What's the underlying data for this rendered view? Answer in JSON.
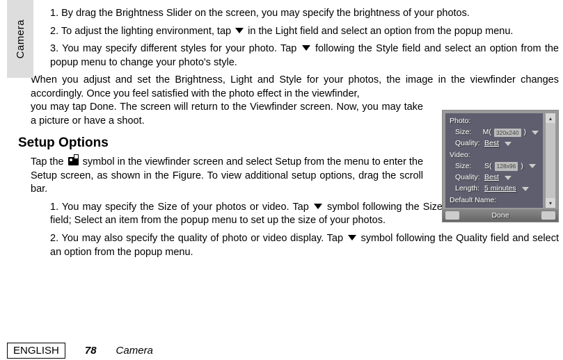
{
  "sideTab": "Camera",
  "list": {
    "i1": "1. By drag the Brightness Slider on the screen, you may specify the brightness of your photos.",
    "i2a": "2.  To adjust the lighting environment, tap ",
    "i2b": " in the Light field and select an option from the popup menu.",
    "i3a": "3.  You may specify different styles for your photo. Tap ",
    "i3b": " following the Style field and select an option from the popup menu to change your photo's style."
  },
  "para1": "When you adjust and set the Brightness, Light and Style for your photos, the image in the viewfinder changes accordingly. Once you feel satisfied with the photo effect in the viewfinder, you may tap Done. The screen will return to the Viewfinder screen. Now, you may take a picture or have a shoot.",
  "heading": "Setup Options",
  "setup": {
    "a": "Tap the ",
    "b": " symbol in the viewfinder screen and select Setup from the menu to enter the Setup screen, as shown in the Figure. To view additional setup options, drag the scroll bar."
  },
  "sub1a": "1. You may specify the Size of your photos or video. Tap ",
  "sub1b": " symbol following the Size field; Select an item from the popup menu to set up the size of your photos.",
  "sub2a": "2. You may also specify the quality of photo or video display. Tap ",
  "sub2b": " symbol following the Quality field and select an option from the popup menu.",
  "footer": {
    "eng": "ENGLISH",
    "page": "78",
    "section": "Camera"
  },
  "panel": {
    "photo": {
      "title": "Photo:",
      "sizeLbl": "Size:",
      "sizeVal": "M(",
      "sizePx": "320x240",
      "sizeClose": ")",
      "qualityLbl": "Quality:",
      "qualityVal": "Best"
    },
    "video": {
      "title": "Video:",
      "sizeLbl": "Size:",
      "sizeVal": "S(",
      "sizePx": "128x96",
      "sizeClose": ")",
      "qualityLbl": "Quality:",
      "qualityVal": "Best",
      "lengthLbl": "Length:",
      "lengthVal": "5 minutes"
    },
    "defaultName": "Default Name:",
    "done": "Done"
  }
}
